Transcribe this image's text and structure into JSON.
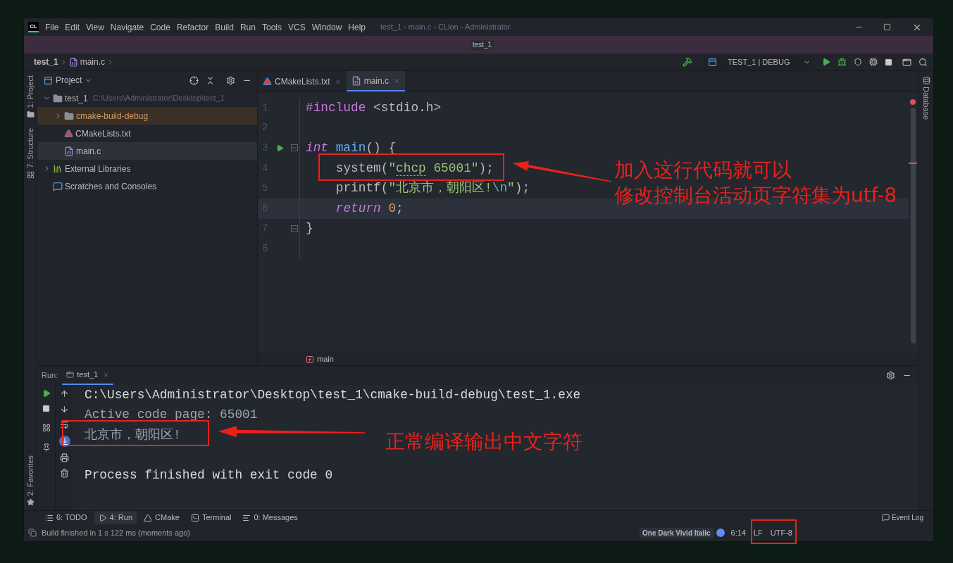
{
  "window": {
    "logo": "CL",
    "menu": [
      "File",
      "Edit",
      "View",
      "Navigate",
      "Code",
      "Refactor",
      "Build",
      "Run",
      "Tools",
      "VCS",
      "Window",
      "Help"
    ],
    "title": "test_1 - main.c - CLion - Administrator",
    "project_tab": "test_1"
  },
  "navbar": {
    "breadcrumb": [
      "test_1",
      "main.c"
    ],
    "run_config": "TEST_1 | DEBUG"
  },
  "tool_strips": {
    "left_top": [
      "1: Project",
      "7: Structure"
    ],
    "left_bottom": [
      "2: Favorites"
    ],
    "right": [
      "Database"
    ]
  },
  "project": {
    "title": "Project",
    "tree": [
      {
        "name": "test_1",
        "hint": "C:\\Users\\Administrator\\Desktop\\test_1",
        "kind": "folder",
        "expanded": true,
        "selected": false,
        "excluded": false,
        "children": [
          {
            "name": "cmake-build-debug",
            "kind": "folder",
            "expanded": false,
            "selected": false,
            "excluded": true
          },
          {
            "name": "CMakeLists.txt",
            "kind": "cmake",
            "selected": false,
            "excluded": false
          },
          {
            "name": "main.c",
            "kind": "c-file",
            "selected": true,
            "excluded": false
          }
        ]
      },
      {
        "name": "External Libraries",
        "kind": "libraries",
        "expanded": false,
        "selected": false,
        "excluded": false
      },
      {
        "name": "Scratches and Consoles",
        "kind": "scratches",
        "selected": false,
        "excluded": false
      }
    ]
  },
  "editor": {
    "tabs": [
      {
        "label": "CMakeLists.txt",
        "kind": "cmake",
        "selected": false
      },
      {
        "label": "main.c",
        "kind": "c-file",
        "selected": true
      }
    ],
    "lines": [
      {
        "number": "1",
        "run_marker": false,
        "fold": false,
        "current": false,
        "tokens": [
          {
            "text": "#include",
            "kind": "directive"
          },
          {
            "text": " <stdio.h>",
            "kind": "plain"
          }
        ]
      },
      {
        "number": "2",
        "run_marker": false,
        "fold": false,
        "current": false
      },
      {
        "number": "3",
        "run_marker": true,
        "fold": true,
        "current": false,
        "tokens": [
          {
            "text": "int",
            "kind": "keyword"
          },
          {
            "text": " main",
            "kind": "func"
          },
          {
            "text": "() {",
            "kind": "plain"
          }
        ]
      },
      {
        "number": "4",
        "run_marker": false,
        "fold": false,
        "current": false,
        "tokens": [
          {
            "text": "    system(",
            "kind": "plain"
          },
          {
            "text": "\"",
            "kind": "string"
          },
          {
            "text": "chcp",
            "kind": "typo"
          },
          {
            "text": " 65001\"",
            "kind": "string"
          },
          {
            "text": ");",
            "kind": "plain"
          }
        ]
      },
      {
        "number": "5",
        "run_marker": false,
        "fold": false,
        "current": false,
        "tokens": [
          {
            "text": "    printf(",
            "kind": "plain"
          },
          {
            "text": "\"北京市，朝阳区!",
            "kind": "string"
          },
          {
            "text": "\\n",
            "kind": "escape"
          },
          {
            "text": "\"",
            "kind": "string"
          },
          {
            "text": ");",
            "kind": "plain"
          }
        ]
      },
      {
        "number": "6",
        "run_marker": false,
        "fold": false,
        "current": true,
        "tokens": [
          {
            "text": "    return",
            "kind": "keyword"
          },
          {
            "text": " 0",
            "kind": "number"
          },
          {
            "text": ";",
            "kind": "plain"
          }
        ]
      },
      {
        "number": "7",
        "run_marker": false,
        "fold": true,
        "current": false,
        "tokens": [
          {
            "text": "}",
            "kind": "plain"
          }
        ]
      },
      {
        "number": "8",
        "run_marker": false,
        "fold": false,
        "current": false
      }
    ],
    "breadcrumb": "main"
  },
  "run": {
    "label": "Run:",
    "tab": {
      "label": "test_1",
      "selected": true
    },
    "output": [
      {
        "text": "C:\\Users\\Administrator\\Desktop\\test_1\\cmake-build-debug\\test_1.exe",
        "kind": "command"
      },
      {
        "text": "Active code page: 65001",
        "kind": "output"
      },
      {
        "text": "北京市，朝阳区!",
        "kind": "output"
      },
      {
        "text": "Process finished with exit code 0",
        "kind": "exit"
      }
    ]
  },
  "tool_tabs": [
    {
      "label": "6: TODO",
      "kind": "todo",
      "selected": false
    },
    {
      "label": "4: Run",
      "kind": "run",
      "selected": true
    },
    {
      "label": "CMake",
      "kind": "cmake",
      "selected": false
    },
    {
      "label": "Terminal",
      "kind": "terminal",
      "selected": false
    },
    {
      "label": "0: Messages",
      "kind": "messages",
      "selected": false
    }
  ],
  "event_log": "Event Log",
  "status": {
    "message": "Build finished in 1 s 122 ms (moments ago)",
    "theme": "One Dark Vivid Italic",
    "position": "6:14",
    "line_separator": "LF",
    "encoding": "UTF-8"
  },
  "annotations": {
    "code_note": [
      "加入这行代码就可以",
      "修改控制台活动页字符集为utf-8"
    ],
    "output_note": "正常编译输出中文字符"
  }
}
